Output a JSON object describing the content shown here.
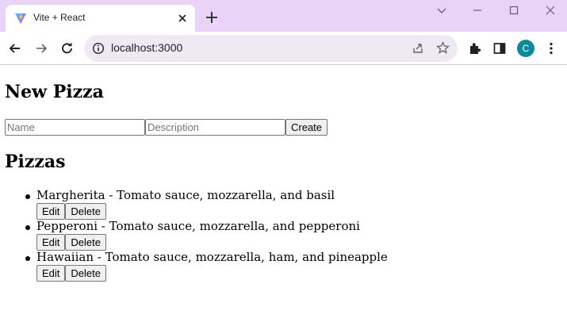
{
  "browser": {
    "tab_title": "Vite + React",
    "url": "localhost:3000",
    "profile_initial": "C"
  },
  "new_pizza": {
    "heading": "New Pizza",
    "name_placeholder": "Name",
    "name_value": "",
    "description_placeholder": "Description",
    "description_value": "",
    "create_label": "Create"
  },
  "pizzas": {
    "heading": "Pizzas",
    "items": [
      {
        "text": "Margherita - Tomato sauce, mozzarella, and basil",
        "edit_label": "Edit",
        "delete_label": "Delete"
      },
      {
        "text": "Pepperoni - Tomato sauce, mozzarella, and pepperoni",
        "edit_label": "Edit",
        "delete_label": "Delete"
      },
      {
        "text": "Hawaiian - Tomato sauce, mozzarella, ham, and pineapple",
        "edit_label": "Edit",
        "delete_label": "Delete"
      }
    ]
  }
}
